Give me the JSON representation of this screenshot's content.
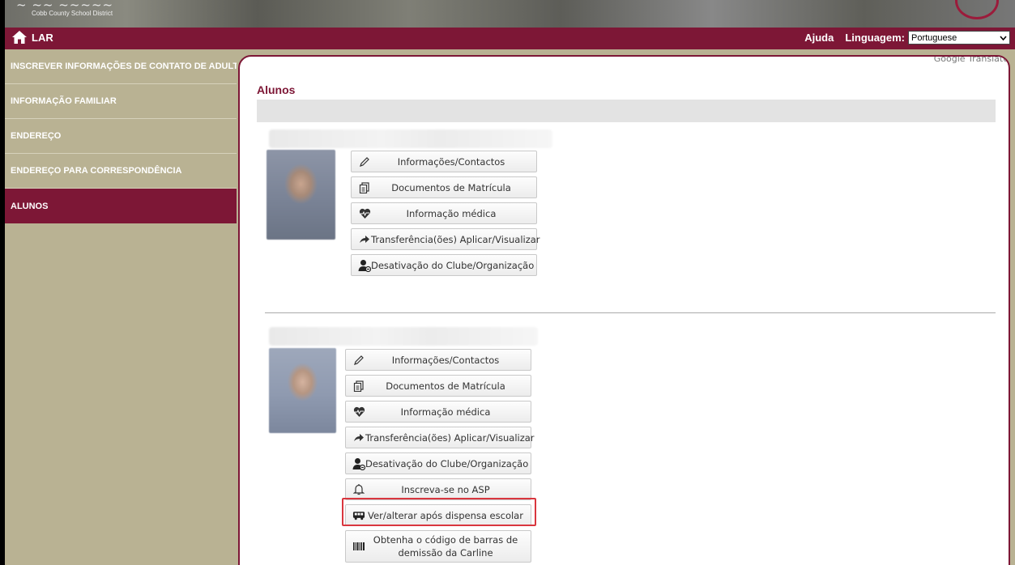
{
  "banner": {
    "district": "Cobb County School District"
  },
  "header": {
    "home_label": "LAR",
    "help_label": "Ajuda",
    "language_label": "Linguagem:",
    "language_selected": "Portuguese"
  },
  "sidebar": {
    "items": [
      {
        "label": "INSCREVER INFORMAÇÕES DE CONTATO DE ADULTOS"
      },
      {
        "label": "INFORMAÇÃO FAMILIAR"
      },
      {
        "label": "ENDEREÇO"
      },
      {
        "label": "ENDEREÇO PARA CORRESPONDÊNCIA"
      },
      {
        "label": "ALUNOS"
      }
    ]
  },
  "main": {
    "title": "Alunos",
    "google_translate": "Google Translate",
    "student1": {
      "buttons": [
        {
          "icon": "pencil-icon",
          "label": "Informações/Contactos"
        },
        {
          "icon": "documents-icon",
          "label": "Documentos de Matrícula"
        },
        {
          "icon": "heartbeat-icon",
          "label": "Informação médica"
        },
        {
          "icon": "arrow-right-icon",
          "label": "Transferência(ões) Aplicar/Visualizar"
        },
        {
          "icon": "user-minus-icon",
          "label": "Desativação do Clube/Organização"
        }
      ]
    },
    "student2": {
      "buttons": [
        {
          "icon": "pencil-icon",
          "label": "Informações/Contactos"
        },
        {
          "icon": "documents-icon",
          "label": "Documentos de Matrícula"
        },
        {
          "icon": "heartbeat-icon",
          "label": "Informação médica"
        },
        {
          "icon": "arrow-right-icon",
          "label": "Transferência(ões) Aplicar/Visualizar"
        },
        {
          "icon": "user-minus-icon",
          "label": "Desativação do Clube/Organização"
        },
        {
          "icon": "bell-icon",
          "label": "Inscreva-se no ASP"
        },
        {
          "icon": "bus-icon",
          "label": "Ver/alterar após dispensa escolar"
        },
        {
          "icon": "barcode-icon",
          "label": "Obtenha o código de barras de demissão da Carline"
        }
      ]
    }
  },
  "colors": {
    "maroon": "#7d1736",
    "sidebar": "#b9b293",
    "highlight": "#d9363e"
  }
}
